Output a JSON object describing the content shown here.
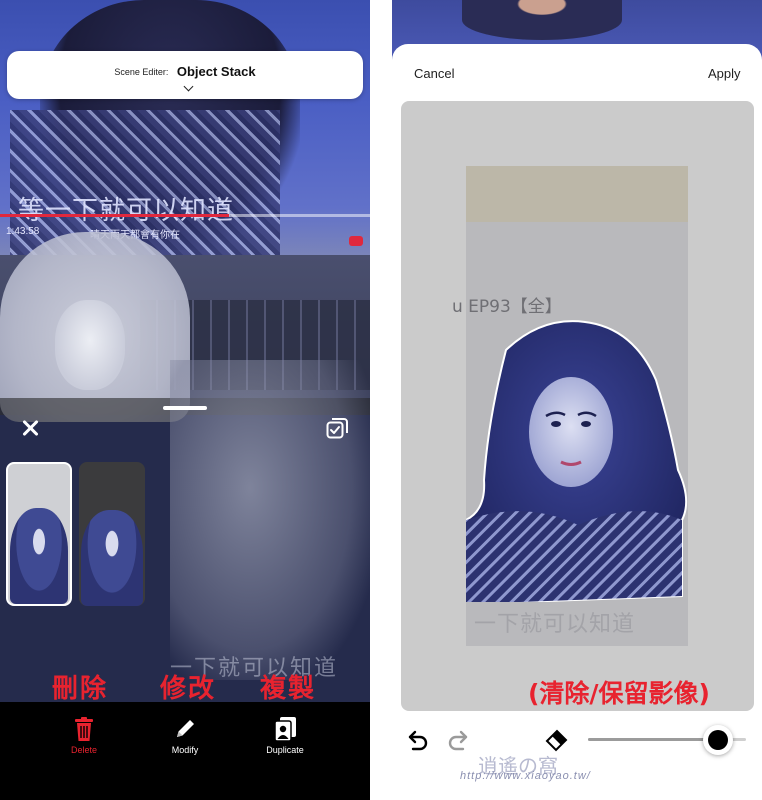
{
  "left": {
    "video": {
      "subtitle": "等一下就可以知道",
      "time": "1:43:58",
      "time_right": "晴天雨天都會有你在",
      "progress": 0.62
    },
    "scene_editor": {
      "label": "Scene Editer:",
      "value": "Object Stack"
    },
    "sheet": {
      "thumbnails": [
        {
          "selected": true
        },
        {
          "selected": false
        }
      ],
      "background_subtitle": "一下就可以知道"
    },
    "annotations": [
      "刪除",
      "修改",
      "複製"
    ],
    "toolbar": {
      "delete": "Delete",
      "modify": "Modify",
      "duplicate": "Duplicate",
      "delete_color": "#e8232f"
    }
  },
  "right": {
    "cancel": "Cancel",
    "apply": "Apply",
    "photo_text": "u EP93【全】",
    "photo_subtitle": "一下就可以知道",
    "annotation": "(清除/保留影像)",
    "brush_size": 0.82,
    "watermark": "http://www.xiaoyao.tw/",
    "watermark_logo": "逍遙の窩"
  },
  "colors": {
    "accent_red": "#e8232f",
    "canvas_gray": "#cbcbcb"
  }
}
